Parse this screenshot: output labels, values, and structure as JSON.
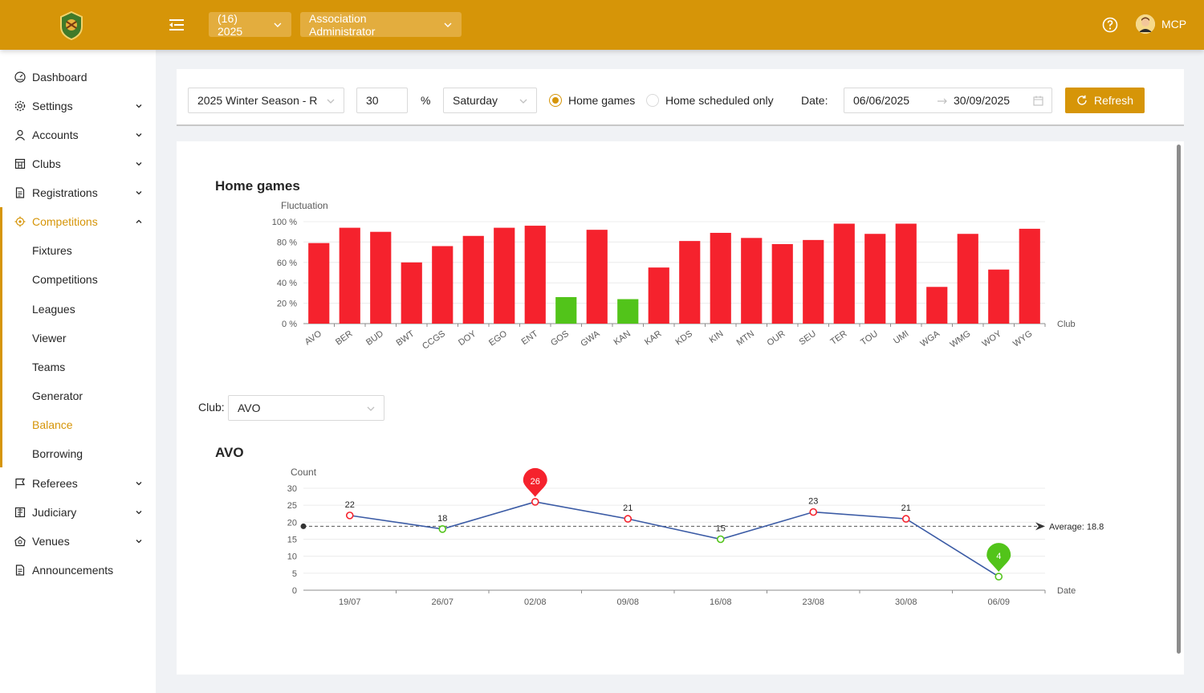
{
  "header": {
    "season_select": "(16) 2025",
    "role_select": "Association Administrator",
    "user_name": "MCP"
  },
  "sidebar": {
    "items": [
      {
        "label": "Dashboard",
        "icon": "dashboard-icon",
        "has_arrow": false
      },
      {
        "label": "Settings",
        "icon": "gear-icon",
        "has_arrow": true
      },
      {
        "label": "Accounts",
        "icon": "user-icon",
        "has_arrow": true
      },
      {
        "label": "Clubs",
        "icon": "building-icon",
        "has_arrow": true
      },
      {
        "label": "Registrations",
        "icon": "document-icon",
        "has_arrow": true
      },
      {
        "label": "Competitions",
        "icon": "target-icon",
        "has_arrow": true,
        "expanded": true,
        "active": true
      },
      {
        "label": "Fixtures",
        "sub": true
      },
      {
        "label": "Competitions",
        "sub": true
      },
      {
        "label": "Leagues",
        "sub": true
      },
      {
        "label": "Viewer",
        "sub": true
      },
      {
        "label": "Teams",
        "sub": true
      },
      {
        "label": "Generator",
        "sub": true
      },
      {
        "label": "Balance",
        "sub": true,
        "active": true
      },
      {
        "label": "Borrowing",
        "sub": true
      },
      {
        "label": "Referees",
        "icon": "flag-icon",
        "has_arrow": true
      },
      {
        "label": "Judiciary",
        "icon": "gavel-icon",
        "has_arrow": true
      },
      {
        "label": "Venues",
        "icon": "venue-icon",
        "has_arrow": true
      },
      {
        "label": "Announcements",
        "icon": "announcement-icon",
        "has_arrow": false
      }
    ]
  },
  "filters": {
    "season": "2025 Winter Season - R",
    "threshold": "30",
    "percent_sign": "%",
    "day": "Saturday",
    "radio_home_games": "Home games",
    "radio_home_scheduled": "Home scheduled only",
    "date_label": "Date:",
    "date_from": "06/06/2025",
    "date_to": "30/09/2025",
    "refresh_label": "Refresh"
  },
  "club_filter": {
    "label": "Club:",
    "value": "AVO"
  },
  "colors": {
    "accent": "#d69508",
    "bar_over": "#f5222d",
    "bar_under": "#52c41a",
    "line": "#3b5ba5"
  },
  "chart_data": [
    {
      "type": "bar",
      "title": "Home games",
      "ylabel": "Fluctuation",
      "xlabel": "Club",
      "ylim": [
        0,
        100
      ],
      "yticks": [
        "0 %",
        "20 %",
        "40 %",
        "60 %",
        "80 %",
        "100 %"
      ],
      "categories": [
        "AVO",
        "BER",
        "BUD",
        "BWT",
        "CCGS",
        "DOY",
        "EGO",
        "ENT",
        "GOS",
        "GWA",
        "KAN",
        "KAR",
        "KDS",
        "KIN",
        "MTN",
        "OUR",
        "SEU",
        "TER",
        "TOU",
        "UMI",
        "WGA",
        "WMG",
        "WOY",
        "WYG"
      ],
      "values": [
        79,
        94,
        90,
        60,
        76,
        86,
        94,
        96,
        26,
        92,
        24,
        55,
        81,
        89,
        84,
        78,
        82,
        98,
        88,
        98,
        36,
        88,
        53,
        93
      ],
      "grid": true
    },
    {
      "type": "line",
      "title": "AVO",
      "ylabel": "Count",
      "xlabel": "Date",
      "ylim": [
        0,
        30
      ],
      "yticks": [
        "0",
        "5",
        "10",
        "15",
        "20",
        "25",
        "30"
      ],
      "categories": [
        "19/07",
        "26/07",
        "02/08",
        "09/08",
        "16/08",
        "23/08",
        "30/08",
        "06/09"
      ],
      "values": [
        22,
        18,
        26,
        21,
        15,
        23,
        21,
        4
      ],
      "average": 18.8,
      "average_label": "Average: 18.8",
      "max_marker": "26",
      "min_marker": "4",
      "grid": true
    }
  ]
}
